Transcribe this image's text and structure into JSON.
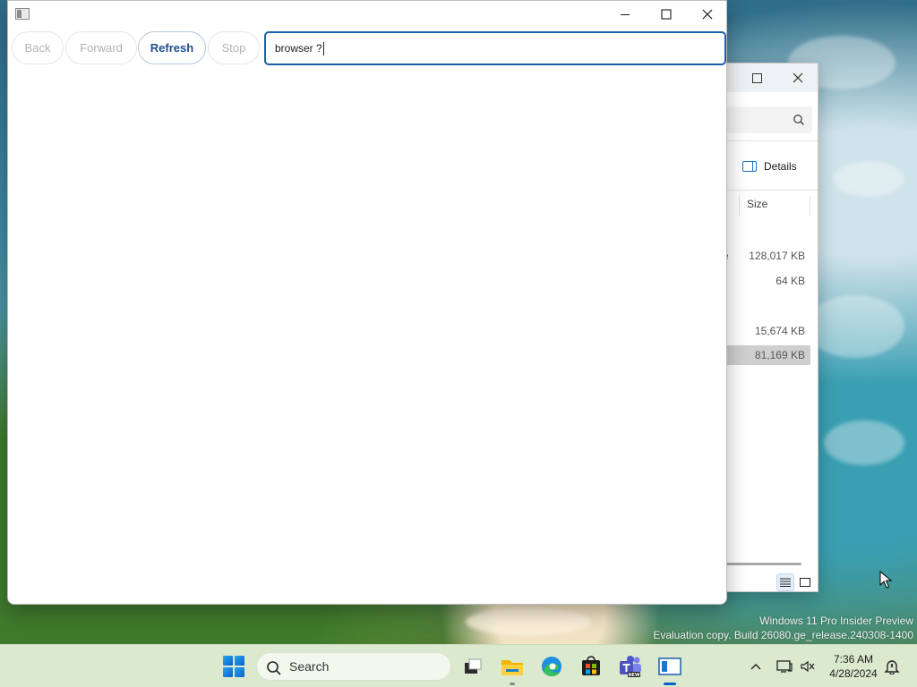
{
  "browser": {
    "toolbar": {
      "back_label": "Back",
      "forward_label": "Forward",
      "refresh_label": "Refresh",
      "stop_label": "Stop"
    },
    "address": {
      "value": "browser ?"
    },
    "window_buttons": [
      "minimize-icon",
      "maximize-icon",
      "close-icon"
    ]
  },
  "explorer": {
    "details_label": "Details",
    "size_column": "Size",
    "rows": [
      {
        "trail": "e",
        "size": "128,017 KB",
        "selected": false
      },
      {
        "trail": ".",
        "size": "64 KB",
        "selected": false
      },
      {
        "trail": ".",
        "size": "15,674 KB",
        "selected": false
      },
      {
        "trail": ".",
        "size": "81,169 KB",
        "selected": true
      }
    ]
  },
  "desktop": {
    "watermark_line1": "Windows 11 Pro Insider Preview",
    "watermark_line2": "Evaluation copy. Build 26080.ge_release.240308-1400"
  },
  "taskbar": {
    "search_label": "Search",
    "apps": [
      "task-view-icon",
      "file-explorer-icon",
      "edge-icon",
      "store-icon",
      "teams-icon",
      "browser-app-icon"
    ],
    "active_app": "browser-app-icon",
    "clock": {
      "time": "7:36 AM",
      "date": "4/28/2024"
    }
  },
  "colors": {
    "accent": "#1f5fae",
    "taskbar": "#dbe9cf"
  }
}
